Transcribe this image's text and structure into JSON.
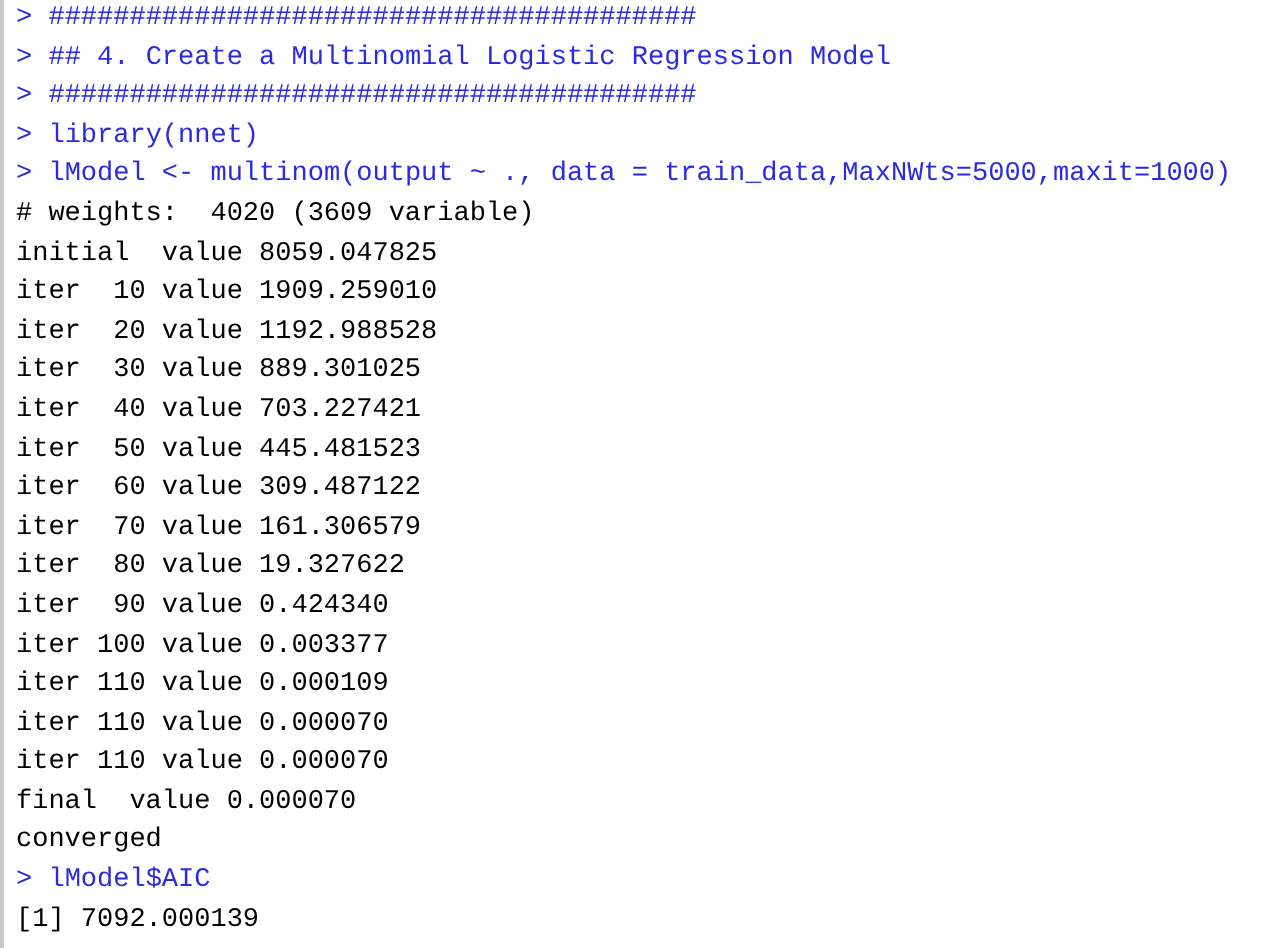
{
  "console": {
    "lines": [
      {
        "kind": "input",
        "prompt": ">",
        "text": "########################################"
      },
      {
        "kind": "input",
        "prompt": ">",
        "text": "## 4. Create a Multinomial Logistic Regression Model"
      },
      {
        "kind": "input",
        "prompt": ">",
        "text": "########################################"
      },
      {
        "kind": "input",
        "prompt": ">",
        "text": "library(nnet)"
      },
      {
        "kind": "input",
        "prompt": ">",
        "text": "lModel <- multinom(output ~ ., data = train_data,MaxNWts=5000,maxit=1000)"
      },
      {
        "kind": "output",
        "text": "# weights:  4020 (3609 variable)"
      },
      {
        "kind": "output",
        "text": "initial  value 8059.047825"
      },
      {
        "kind": "output",
        "text": "iter  10 value 1909.259010"
      },
      {
        "kind": "output",
        "text": "iter  20 value 1192.988528"
      },
      {
        "kind": "output",
        "text": "iter  30 value 889.301025"
      },
      {
        "kind": "output",
        "text": "iter  40 value 703.227421"
      },
      {
        "kind": "output",
        "text": "iter  50 value 445.481523"
      },
      {
        "kind": "output",
        "text": "iter  60 value 309.487122"
      },
      {
        "kind": "output",
        "text": "iter  70 value 161.306579"
      },
      {
        "kind": "output",
        "text": "iter  80 value 19.327622"
      },
      {
        "kind": "output",
        "text": "iter  90 value 0.424340"
      },
      {
        "kind": "output",
        "text": "iter 100 value 0.003377"
      },
      {
        "kind": "output",
        "text": "iter 110 value 0.000109"
      },
      {
        "kind": "output",
        "text": "iter 110 value 0.000070"
      },
      {
        "kind": "output",
        "text": "iter 110 value 0.000070"
      },
      {
        "kind": "output",
        "text": "final  value 0.000070"
      },
      {
        "kind": "output",
        "text": "converged"
      },
      {
        "kind": "input",
        "prompt": ">",
        "text": "lModel$AIC"
      },
      {
        "kind": "output",
        "text": "[1] 7092.000139"
      }
    ]
  }
}
